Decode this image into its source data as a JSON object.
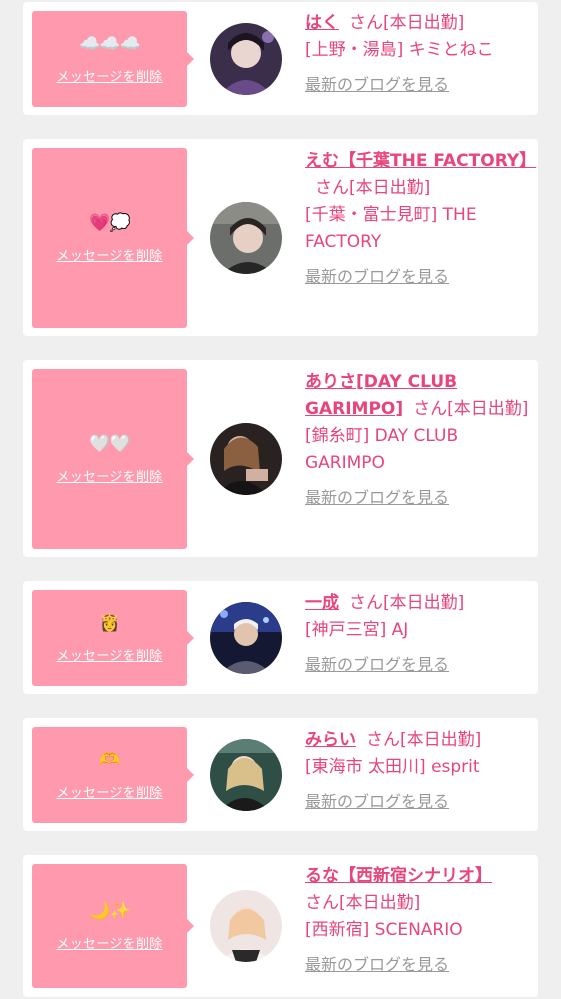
{
  "colors": {
    "background": "#efefef",
    "card": "#ffffff",
    "accent_pink": "#ff9aae",
    "cast_text": "#e8457a",
    "link_gray": "#999999"
  },
  "delete_label": "メッセージを削除",
  "blog_label": "最新のブログを見る",
  "messages": [
    {
      "emoji": "☁️☁️☁️",
      "name": "はく",
      "suffix": "さん[本日出勤]",
      "shop": "[上野・湯島] キミとねこ"
    },
    {
      "emoji": "💗💭",
      "name": "えむ【千葉THE FACTORY】",
      "suffix": "さん[本日出勤]",
      "shop": "[千葉・富士見町] THE FACTORY"
    },
    {
      "emoji": "🤍🤍",
      "name": "ありさ[DAY CLUB GARIMPO]",
      "suffix": "さん[本日出勤]",
      "shop": "[錦糸町] DAY CLUB GARIMPO"
    },
    {
      "emoji": "👸",
      "name": "一成",
      "suffix": "さん[本日出勤]",
      "shop": "[神戸三宮] AJ"
    },
    {
      "emoji": "🫶",
      "name": "みらい",
      "suffix": "さん[本日出勤]",
      "shop": "[東海市 太田川] esprit"
    },
    {
      "emoji": "🌙✨",
      "name": "るな【西新宿シナリオ】",
      "suffix": "さん[本日出勤]",
      "shop": "[西新宿] SCENARIO"
    }
  ]
}
